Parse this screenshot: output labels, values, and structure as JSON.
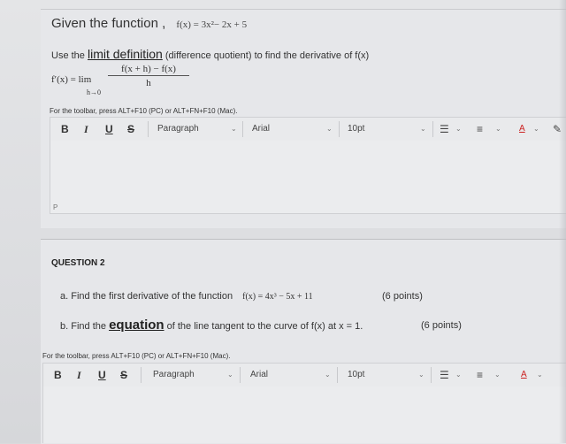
{
  "question1": {
    "given_text": "Given the function ,",
    "function_expr": "f(x) = 3x²− 2x + 5",
    "use_prefix": "Use the",
    "limit_link": "limit definition",
    "use_suffix": "(difference quotient) to find the derivative of f(x)",
    "derivative_lhs": "f′(x) = lim",
    "fraction_numerator": "f(x + h) − f(x)",
    "fraction_denominator": "h",
    "limit_subscript": "h→0",
    "toolbar_hint": "For the toolbar, press ALT+F10 (PC) or ALT+FN+F10 (Mac).",
    "editor_placeholder": "P"
  },
  "toolbar": {
    "bold": "B",
    "italic": "I",
    "underline": "U",
    "strike": "S",
    "paragraph": "Paragraph",
    "font": "Arial",
    "size": "10pt",
    "list_icon": "☰",
    "numlist_icon": "≡",
    "color": "A",
    "pencil": "✎",
    "chevron": "⌄"
  },
  "question2": {
    "title": "QUESTION 2",
    "a_label": "a.",
    "a_text": "Find the first derivative of the function",
    "a_expr": "f(x) = 4x³ − 5x + 11",
    "a_points": "(6 points)",
    "b_label": "b.",
    "b_text_pre": "Find the",
    "b_equation": "equation",
    "b_text_post": "of the line tangent to the curve of f(x) at x = 1.",
    "b_points": "(6 points)",
    "toolbar_hint": "For the toolbar, press ALT+F10 (PC) or ALT+FN+F10 (Mac)."
  }
}
